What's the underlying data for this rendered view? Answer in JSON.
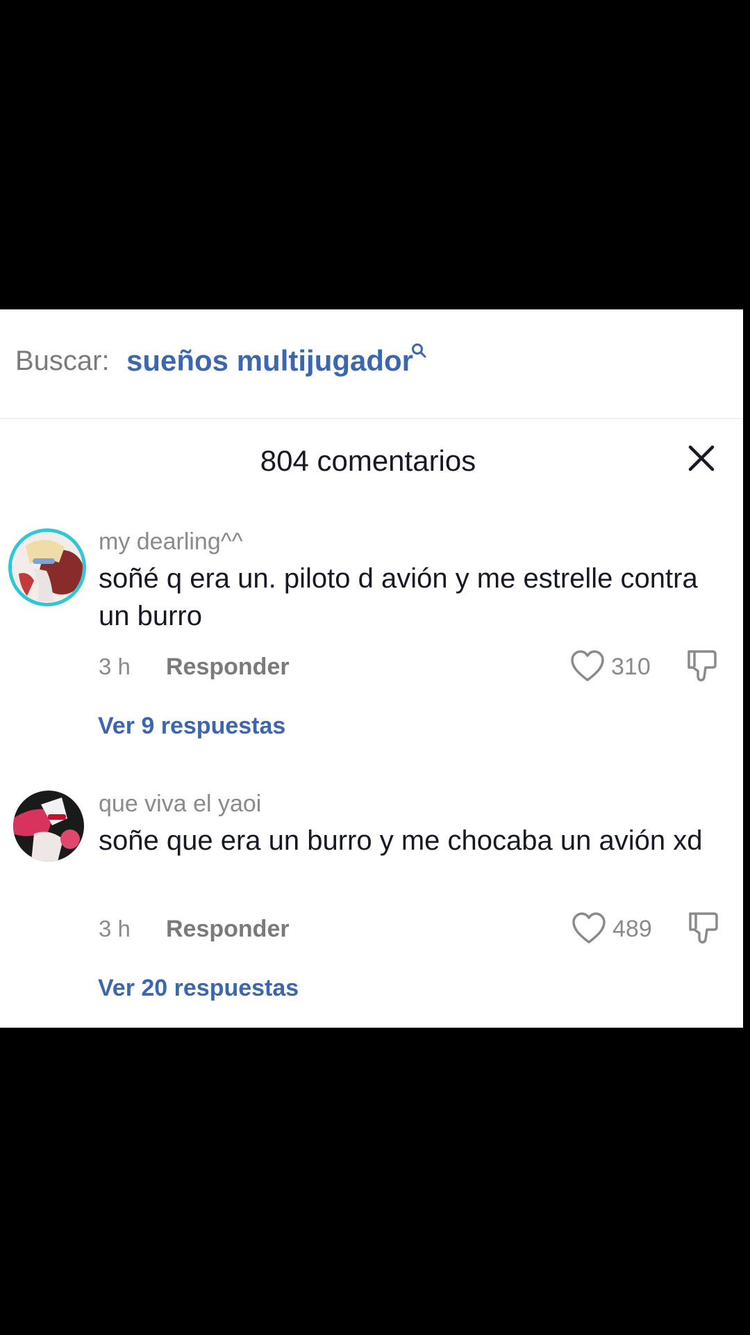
{
  "search": {
    "prefix": "Buscar:",
    "query": "sueños multijugador"
  },
  "header": {
    "title": "804 comentarios"
  },
  "comments": [
    {
      "username": "my dearling^^",
      "text": "soñé q era un. piloto d avión y me estrelle contra un burro",
      "time": "3 h",
      "reply_label": "Responder",
      "likes": "310",
      "view_replies": "Ver 9 respuestas"
    },
    {
      "username": "que viva el yaoi",
      "text": "soñe que era un burro y me chocaba un avión xd",
      "time": "3 h",
      "reply_label": "Responder",
      "likes": "489",
      "view_replies": "Ver 20 respuestas"
    }
  ],
  "colors": {
    "accent_blue": "#3c66ad",
    "avatar_ring": "#2dc7d8",
    "text_dark": "#161823",
    "text_gray": "#8a8a8a"
  },
  "icons": [
    "search-icon",
    "close-icon",
    "heart-icon",
    "thumbs-down-icon"
  ]
}
